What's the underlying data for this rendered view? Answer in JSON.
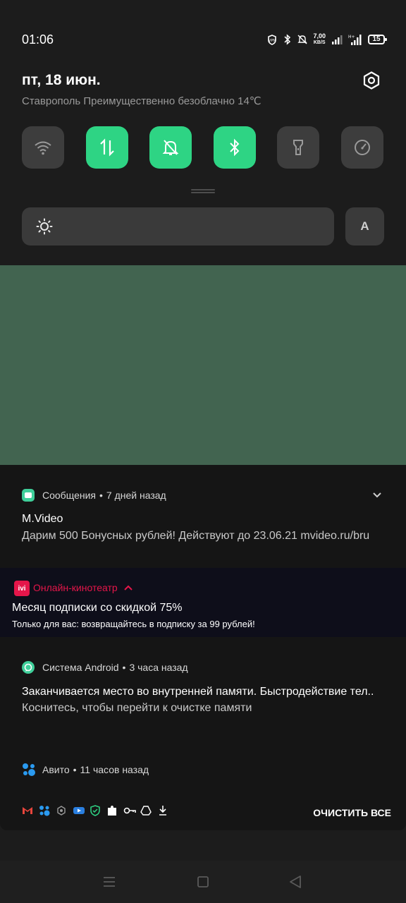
{
  "status_bar": {
    "time": "01:06",
    "speed_value": "7,00",
    "speed_unit": "KB/S",
    "battery": "15"
  },
  "header": {
    "date": "пт, 18 июн.",
    "weather": "Ставрополь Преимущественно безоблачно 14℃"
  },
  "quick_tiles": [
    {
      "icon": "wifi-icon",
      "state": "off"
    },
    {
      "icon": "mobile-data-icon",
      "state": "on"
    },
    {
      "icon": "bell-off-icon",
      "state": "on"
    },
    {
      "icon": "bluetooth-icon",
      "state": "on"
    },
    {
      "icon": "flashlight-icon",
      "state": "off"
    },
    {
      "icon": "speedometer-icon",
      "state": "off"
    }
  ],
  "brightness": {
    "auto_label": "A"
  },
  "colors": {
    "accent": "#2ed484",
    "media_bg": "#426450",
    "ivi_red": "#e5164a"
  },
  "notifications": {
    "messages": {
      "app": "Сообщения",
      "time": "7 дней назад",
      "title": "M.Video",
      "text": "Дарим 500 Бонусных рублей! Действуют до 23.06.21 mvideo.ru/bru"
    },
    "ivi": {
      "logo": "ivi",
      "app": "Онлайн-кинотеатр",
      "title": "Месяц подписки со скидкой 75%",
      "text": "Только для вас: возвращайтесь в подписку за 99 рублей!"
    },
    "android": {
      "app": "Система Android",
      "time": "3 часа назад",
      "title": "Заканчивается место во внутренней памяти. Быстродействие тел..",
      "text": "Коснитесь, чтобы перейти к очистке памяти"
    },
    "avito": {
      "app": "Авито",
      "time": "11 часов назад"
    },
    "separator": "•"
  },
  "bottom": {
    "clear_all": "ОЧИСТИТЬ ВСЕ"
  }
}
